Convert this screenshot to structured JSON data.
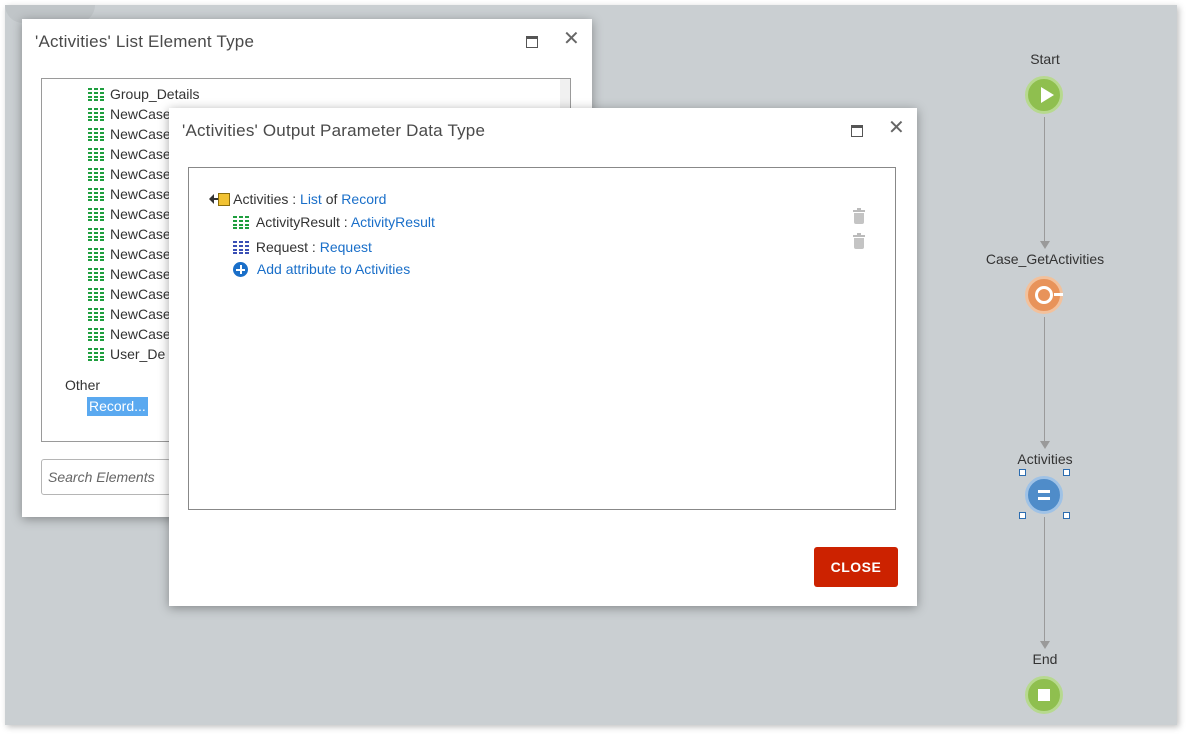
{
  "flow": {
    "start_label": "Start",
    "action_label": "Case_GetActivities",
    "assign_label": "Activities",
    "end_label": "End"
  },
  "list_dialog": {
    "title": "'Activities' List Element Type",
    "items": [
      "Group_Details",
      "NewCase",
      "NewCase",
      "NewCase",
      "NewCase",
      "NewCase",
      "NewCase",
      "NewCase",
      "NewCase",
      "NewCase",
      "NewCase",
      "NewCase",
      "NewCase",
      "User_De"
    ],
    "other_label": "Other",
    "selected_item": "Record...",
    "search_placeholder": "Search Elements"
  },
  "param_dialog": {
    "title": "'Activities' Output Parameter Data Type",
    "root": {
      "name": "Activities",
      "sep": " : ",
      "type_list": "List",
      "of": " of ",
      "type_record": "Record"
    },
    "attributes": [
      {
        "name": "ActivityResult",
        "sep": " : ",
        "type": "ActivityResult",
        "icon_color": "#1e9e3e"
      },
      {
        "name": "Request",
        "sep": " : ",
        "type": "Request",
        "icon_color": "#3a4fb5"
      }
    ],
    "add_attribute_label": "Add attribute to Activities",
    "close_label": "CLOSE"
  },
  "colors": {
    "link": "#1a6fc9",
    "close_button": "#cc2200",
    "selection": "#5aa9f0",
    "canvas": "#cacfd2"
  }
}
